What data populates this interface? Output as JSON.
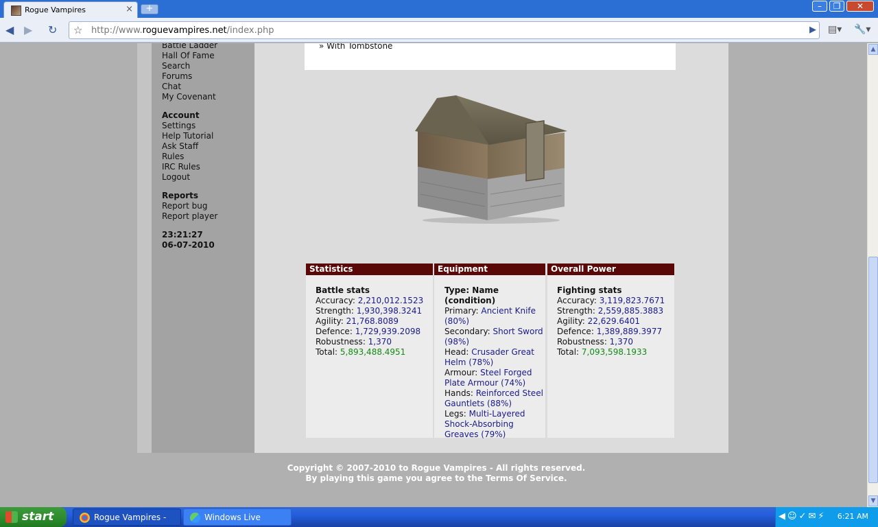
{
  "browser": {
    "tab_title": "Rogue Vampires",
    "tab_close": "×",
    "new_tab": "+",
    "url_prefix": "http://www.",
    "url_domain": "roguevampires.net",
    "url_path": "/index.php",
    "window_controls": [
      "minimize",
      "maximize",
      "close"
    ]
  },
  "sidebar": {
    "community_items": [
      "Battle Ladder",
      "Hall Of Fame",
      "Search",
      "Forums",
      "Chat",
      "My Covenant"
    ],
    "account": {
      "heading": "Account",
      "items": [
        "Settings",
        "Help Tutorial",
        "Ask Staff",
        "Rules",
        "IRC Rules",
        "Logout"
      ]
    },
    "reports": {
      "heading": "Reports",
      "items": [
        "Report bug",
        "Report player"
      ]
    },
    "time": "23:21:27",
    "date": "06-07-2010"
  },
  "main": {
    "top_box_text": "» With Tombstone",
    "statistics": {
      "title": "Statistics",
      "subtitle": "Battle stats",
      "rows": [
        {
          "label": "Accuracy: ",
          "value": "2,210,012.1523"
        },
        {
          "label": "Strength: ",
          "value": "1,930,398.3241"
        },
        {
          "label": "Agility: ",
          "value": "21,768.8089"
        },
        {
          "label": "Defence: ",
          "value": "1,729,939.2098"
        },
        {
          "label": "Robustness: ",
          "value": "1,370"
        },
        {
          "label": "Total: ",
          "value": "5,893,488.4951"
        }
      ]
    },
    "equipment": {
      "title": "Equipment",
      "subtitle": "Type: Name (condition)",
      "rows": [
        {
          "label": "Primary: ",
          "value": "Ancient Knife (80%)"
        },
        {
          "label": "Secondary: ",
          "value": "Short Sword (98%)"
        },
        {
          "label": "Head: ",
          "value": "Crusader Great Helm (78%)"
        },
        {
          "label": "Armour: ",
          "value": "Steel Forged Plate Armour (74%)"
        },
        {
          "label": "Hands: ",
          "value": "Reinforced Steel Gauntlets (88%)"
        },
        {
          "label": "Legs: ",
          "value": "Multi-Layered Shock-Absorbing Greaves (79%)"
        }
      ]
    },
    "power": {
      "title": "Overall Power",
      "subtitle": "Fighting stats",
      "rows": [
        {
          "label": "Accuracy: ",
          "value": "3,119,823.7671"
        },
        {
          "label": "Strength: ",
          "value": "2,559,885.3883"
        },
        {
          "label": "Agility: ",
          "value": "22,629.6401"
        },
        {
          "label": "Defence: ",
          "value": "1,389,889.3977"
        },
        {
          "label": "Robustness: ",
          "value": "1,370"
        },
        {
          "label": "Total: ",
          "value": "7,093,598.1933"
        }
      ]
    }
  },
  "footer": {
    "line1": "Copyright © 2007-2010 to Rogue Vampires - All rights reserved.",
    "line2": "By playing this game you agree to the Terms Of Service."
  },
  "taskbar": {
    "start_label": "start",
    "tasks": [
      "Rogue Vampires - Go...",
      "Windows Live Messen..."
    ],
    "clock": "6:21 AM"
  },
  "colors": {
    "panel_header": "#5a0707",
    "link_value": "#1a1a8c",
    "total_value": "#128a12"
  }
}
